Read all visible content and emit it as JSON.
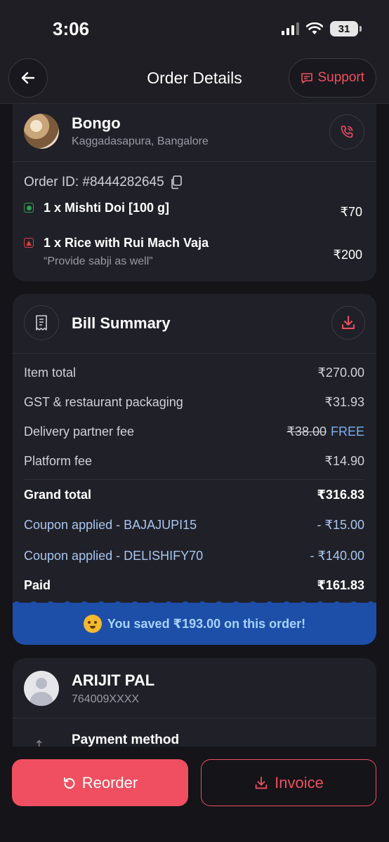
{
  "status_bar": {
    "time": "3:06",
    "battery": "31"
  },
  "header": {
    "title": "Order Details",
    "support_label": "Support"
  },
  "restaurant": {
    "name": "Bongo",
    "address": "Kaggadasapura, Bangalore",
    "order_id": "Order ID: #8444282645",
    "items": [
      {
        "label": "1 x Mishti Doi [100 g]",
        "price": "₹70",
        "type": "veg"
      },
      {
        "label": "1 x Rice with Rui Mach Vaja",
        "note": "“Provide sabji as well”",
        "price": "₹200",
        "type": "non-veg"
      }
    ]
  },
  "bill": {
    "title": "Bill Summary",
    "rows": [
      {
        "label": "Item total",
        "value": "₹270.00"
      },
      {
        "label": "GST & restaurant packaging",
        "value": "₹31.93"
      },
      {
        "label": "Delivery partner fee",
        "old_value": "₹38.00",
        "value": "FREE"
      },
      {
        "label": "Platform fee",
        "value": "₹14.90"
      }
    ],
    "grand_total": {
      "label": "Grand total",
      "value": "₹316.83"
    },
    "coupons": [
      {
        "label": "Coupon applied - BAJAJUPI15",
        "value": "- ₹15.00"
      },
      {
        "label": "Coupon applied - DELISHIFY70",
        "value": "- ₹140.00"
      }
    ],
    "paid": {
      "label": "Paid",
      "value": "₹161.83"
    },
    "savings": "You saved ₹193.00 on this order!"
  },
  "customer": {
    "name": "ARIJIT PAL",
    "phone": "764009XXXX",
    "payment_label": "Payment method"
  },
  "actions": {
    "reorder_label": "Reorder",
    "invoice_label": "Invoice"
  },
  "colors": {
    "accent": "#ef4f60",
    "background": "#141419",
    "card": "#202028",
    "savings_banner": "#1d4fa8",
    "coupon_text": "#a8c6f0"
  },
  "icons": [
    "arrow-left-icon",
    "chat-icon",
    "phone-icon",
    "copy-icon",
    "receipt-icon",
    "download-icon",
    "party-emoji-icon",
    "user-avatar-icon",
    "refresh-icon",
    "invoice-download-icon"
  ]
}
